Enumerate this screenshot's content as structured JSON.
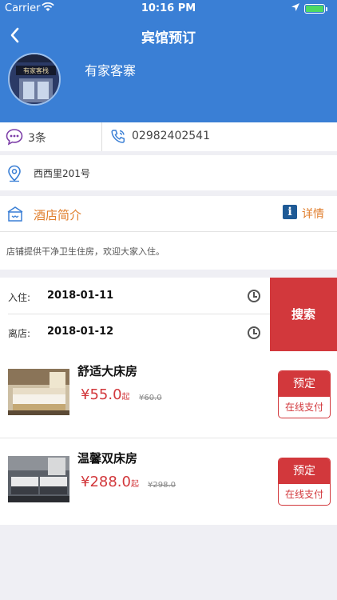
{
  "status_bar": {
    "carrier": "Carrier",
    "time": "10:16 PM",
    "battery_level": 1.0
  },
  "nav": {
    "title": "宾馆预订"
  },
  "hotel": {
    "name": "有家客寨",
    "sign_text": "有家客栈",
    "comment_count": "3条",
    "phone": "02982402541",
    "address": "西西里201号"
  },
  "intro": {
    "title": "酒店简介",
    "detail_label": "详情",
    "text": "店铺提供干净卫生住房，欢迎大家入住。"
  },
  "booking": {
    "checkin_label": "入住:",
    "checkin_date": "2018-01-11",
    "checkout_label": "离店:",
    "checkout_date": "2018-01-12",
    "search_label": "搜索"
  },
  "rooms": [
    {
      "name": "舒适大床房",
      "price": "¥55.0",
      "price_unit": "起",
      "original_price": "¥60.0",
      "book_label": "预定",
      "pay_label": "在线支付"
    },
    {
      "name": "温馨双床房",
      "price": "¥288.0",
      "price_unit": "起",
      "original_price": "¥298.0",
      "book_label": "预定",
      "pay_label": "在线支付"
    }
  ],
  "colors": {
    "header_blue": "#3a7fd5",
    "accent_red": "#d2383c",
    "accent_orange": "#e07e2c",
    "info_blue": "#1e5a96"
  }
}
